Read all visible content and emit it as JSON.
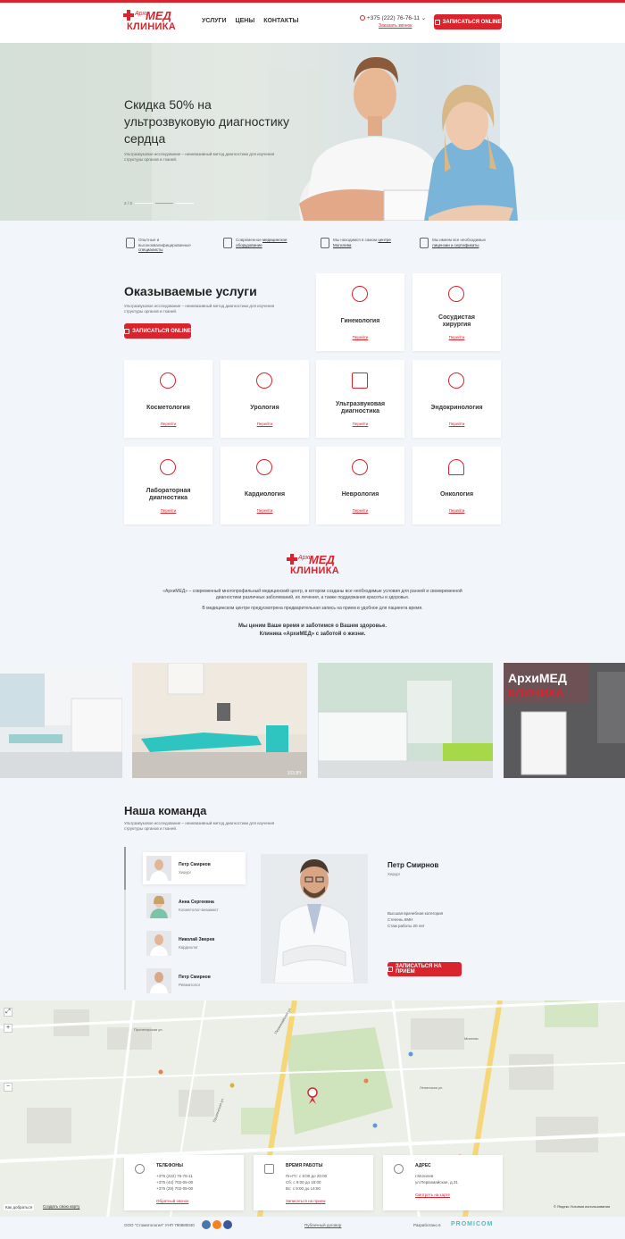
{
  "header": {
    "logo": {
      "small": "Архи",
      "big": "МЕД",
      "bottom": "КЛИНИКА"
    },
    "nav": [
      "УСЛУГИ",
      "ЦЕНЫ",
      "КОНТАКТЫ"
    ],
    "phone": "+375 (222) 76-76-11",
    "callback": "Заказать звонок",
    "cta": "ЗАПИСАТЬСЯ ONLINE"
  },
  "hero": {
    "title": "Скидка 50% на ультрозвуковую диагностику сердца",
    "subtitle": "Ультразвуковое исследование – неинвазивный метод диагностики для изучения структуры органов и тканей.",
    "slide": "2 / 3"
  },
  "features": [
    {
      "icon": "doctor-badge-icon",
      "text": "Опытные и высококвалифицированные ",
      "link": "специалисты"
    },
    {
      "icon": "equipment-icon",
      "text": "Современное ",
      "link": "медицинское оборудование"
    },
    {
      "icon": "location-icon",
      "text": "Мы находимся в самом ",
      "link": "центре Могилева"
    },
    {
      "icon": "flask-icon",
      "text": "Мы имеем все необходимые ",
      "link": "лицензии и сертификаты"
    }
  ],
  "services": {
    "title": "Оказываемые услуги",
    "subtitle": "Ультразвуковое исследование – неинвазивный метод диагностики для изучения структуры органов и тканей.",
    "cta": "ЗАПИСАТЬСЯ ONLINE",
    "more": "Перейти",
    "items": [
      {
        "name": "Гинекология",
        "icon": "uterus-icon"
      },
      {
        "name": "Сосудистая хирургия",
        "icon": "vessels-icon"
      },
      {
        "name": "Косметология",
        "icon": "cosmetology-icon"
      },
      {
        "name": "Урология",
        "icon": "kidneys-icon"
      },
      {
        "name": "Ультразвуковая диагностика",
        "icon": "ultrasound-monitor-icon"
      },
      {
        "name": "Эндокринология",
        "icon": "thyroid-icon"
      },
      {
        "name": "Лабораторная диагностика",
        "icon": "lab-test-icon"
      },
      {
        "name": "Кардиология",
        "icon": "heart-icon"
      },
      {
        "name": "Неврология",
        "icon": "brain-icon"
      },
      {
        "name": "Онкология",
        "icon": "mri-scanner-icon"
      }
    ]
  },
  "about": {
    "p1": "«АрхиМЕД» – современный многопрофильный медицинский центр, в котором созданы все необходимые условия для ранней и своевременной диагностики различных заболеваний, их лечения, а также поддержания красоты и здоровья.",
    "p2": "В медицинском центре предусмотрена предварительная запись на прием в удобное для пациента время.",
    "bold1": "Мы ценим Ваше время и заботимся о Вашем здоровье.",
    "bold2": "Клиника «АрхиМЕД» с заботой о жизни.",
    "photo_credit": "103.BY"
  },
  "team": {
    "title": "Наша команда",
    "subtitle": "Ультразвуковое исследование – неинвазивный метод диагностики для изучения структуры органов и тканей.",
    "members": [
      {
        "name": "Петр Смирнов",
        "role": "Хирург"
      },
      {
        "name": "Анна Сергеевна",
        "role": "Косметолог-визажист"
      },
      {
        "name": "Николай Зверев",
        "role": "Кардиолог"
      },
      {
        "name": "Петр Смирнов",
        "role": "Ревматолог"
      }
    ],
    "selected": {
      "name": "Петр Смирнов",
      "role": "Хирург",
      "info1": "Высшая врачебная категория",
      "info2": "Степень КМН",
      "info3": "Стаж работы 20 лет",
      "cta": "ЗАПИСАТЬСЯ НА ПРИЕМ"
    }
  },
  "contacts": {
    "phones": {
      "title": "ТЕЛЕФОНЫ",
      "l1": "+375 (222) 76-76-11",
      "l2": "+375 (44) 702-05-00",
      "l3": "+375 (29) 702-05-00",
      "link": "Обратный звонок"
    },
    "hours": {
      "title": "ВРЕМЯ РАБОТЫ",
      "l1": "Пн-Пт: с 8:00 до 20:00",
      "l2": "Сб: с 9:00 до 15:00",
      "l3": "Вс: с 9:00 до 14:00",
      "link": "Записаться на прием"
    },
    "address": {
      "title": "АДРЕС",
      "l1": "г.Могилев",
      "l2": "ул.Первомайская, д.31",
      "link": "Смотреть на карте"
    }
  },
  "map": {
    "route": "Как добраться",
    "create": "Создать свою карту",
    "yandex": "© Яндекс Условия использования",
    "labels": [
      "Пролетарская ул.",
      "Первомайская ул.",
      "Ленинская ул.",
      "Мигнево",
      "Пушкинская ул."
    ]
  },
  "footer": {
    "company": "ООО \"Стоматология\" УНП 790880040",
    "policy": "Публичный договор",
    "dev_label": "Разработано в",
    "dev": "PROMICOM"
  },
  "colors": {
    "accent": "#d9232d",
    "bg": "#f2f5fa"
  }
}
